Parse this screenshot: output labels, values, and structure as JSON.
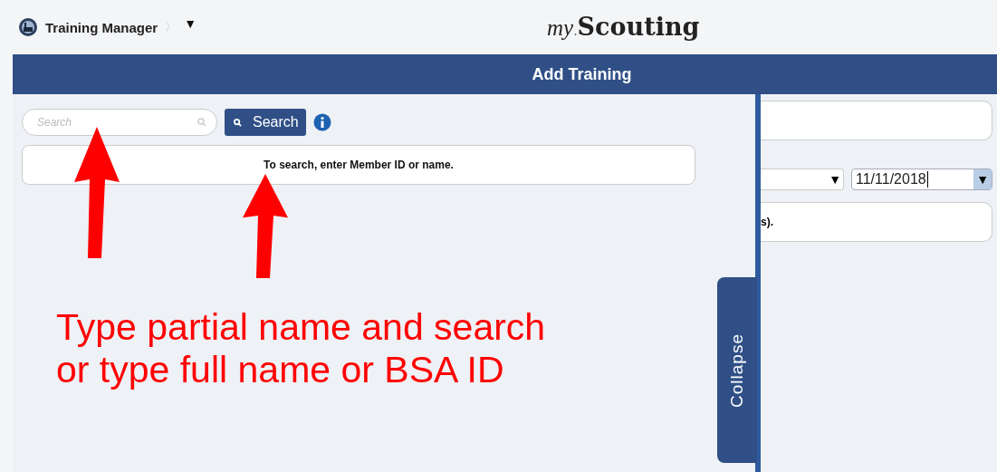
{
  "breadcrumb": {
    "app": "Training Manager",
    "separator": "〉",
    "menu_caret": "▼"
  },
  "logo": {
    "prefix": "my",
    "dot": ".",
    "name": "Scouting"
  },
  "header": {
    "title": "Add Training"
  },
  "search": {
    "placeholder": "Search",
    "button": "Search"
  },
  "message": "To search, enter Member ID or name.",
  "right_panel": {
    "dropdown_caret": "▼",
    "date": "11/11/2018",
    "date_caret": "▼",
    "note": "s)."
  },
  "collapse": {
    "label": "Collapse"
  },
  "annotation": {
    "lines": [
      "Type partial name and search",
      "or type full name or BSA ID"
    ],
    "arrows": [
      {
        "kind": "arrow"
      },
      {
        "kind": "arrow"
      }
    ]
  }
}
